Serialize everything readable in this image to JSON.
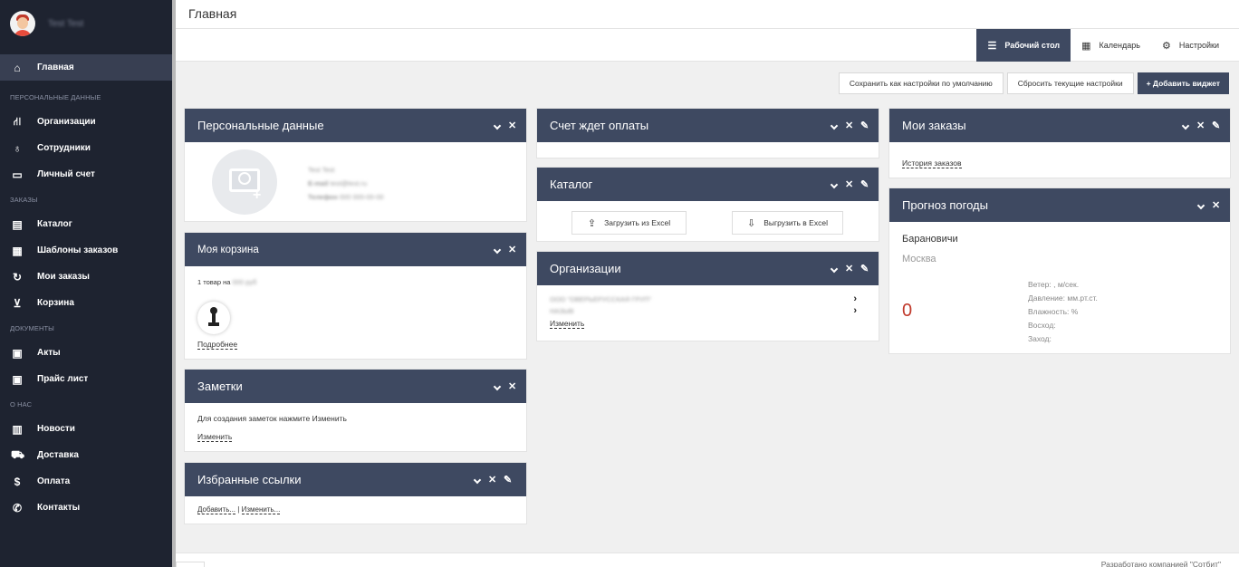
{
  "user": {
    "name": "Test Test"
  },
  "nav": {
    "main": "Главная",
    "section_personal": "ПЕРСОНАЛЬНЫЕ ДАННЫЕ",
    "organizations": "Организации",
    "employees": "Сотрудники",
    "account": "Личный счет",
    "section_orders": "ЗАКАЗЫ",
    "catalog": "Каталог",
    "templates": "Шаблоны заказов",
    "my_orders": "Мои заказы",
    "cart": "Корзина",
    "section_docs": "ДОКУМЕНТЫ",
    "acts": "Акты",
    "price_list": "Прайс лист",
    "section_about": "О НАС",
    "news": "Новости",
    "delivery": "Доставка",
    "payment": "Оплата",
    "contacts": "Контакты"
  },
  "header": {
    "title": "Главная"
  },
  "tabs": {
    "desktop": "Рабочий стол",
    "calendar": "Календарь",
    "settings": "Настройки"
  },
  "actions": {
    "save_default": "Сохранить как настройки по умолчанию",
    "reset": "Сбросить текущие настройки",
    "add_widget": "+ Добавить виджет"
  },
  "widgets": {
    "personal": {
      "title": "Персональные данные",
      "name": "Test Test",
      "email_label": "E-mail",
      "email": "test@test.ru",
      "phone_label": "Телефон",
      "phone": "000 000-00-00"
    },
    "cart": {
      "title": "Моя корзина",
      "summary_prefix": "1 товар на",
      "summary_value": "000 руб",
      "more": "Подробнее"
    },
    "notes": {
      "title": "Заметки",
      "text": "Для создания заметок нажмите Изменить",
      "edit": "Изменить"
    },
    "links": {
      "title": "Избранные ссылки",
      "add": "Добавить...",
      "sep": "|",
      "edit": "Изменить..."
    },
    "invoice": {
      "title": "Счет ждет оплаты"
    },
    "catalog": {
      "title": "Каталог",
      "import": "Загрузить из Excel",
      "export": "Выгрузить в Excel"
    },
    "orgs": {
      "title": "Организации",
      "row1": "ООО \"ОВЕРЬЕРУССКАЯ ГРУП\"",
      "row2": "НАЗЫВ",
      "edit": "Изменить"
    },
    "orders": {
      "title": "Мои заказы",
      "history": "История заказов"
    },
    "weather": {
      "title": "Прогноз погоды",
      "city": "Барановичи",
      "alt_city": "Москва",
      "temp": "0",
      "wind": "Ветер: , м/сек.",
      "pressure": "Давление: мм.рт.ст.",
      "humidity": "Влажность: %",
      "sunrise": "Восход:",
      "sunset": "Заход:"
    }
  },
  "footer": {
    "copyright": "Разработано компанией \"Сотбит\""
  }
}
